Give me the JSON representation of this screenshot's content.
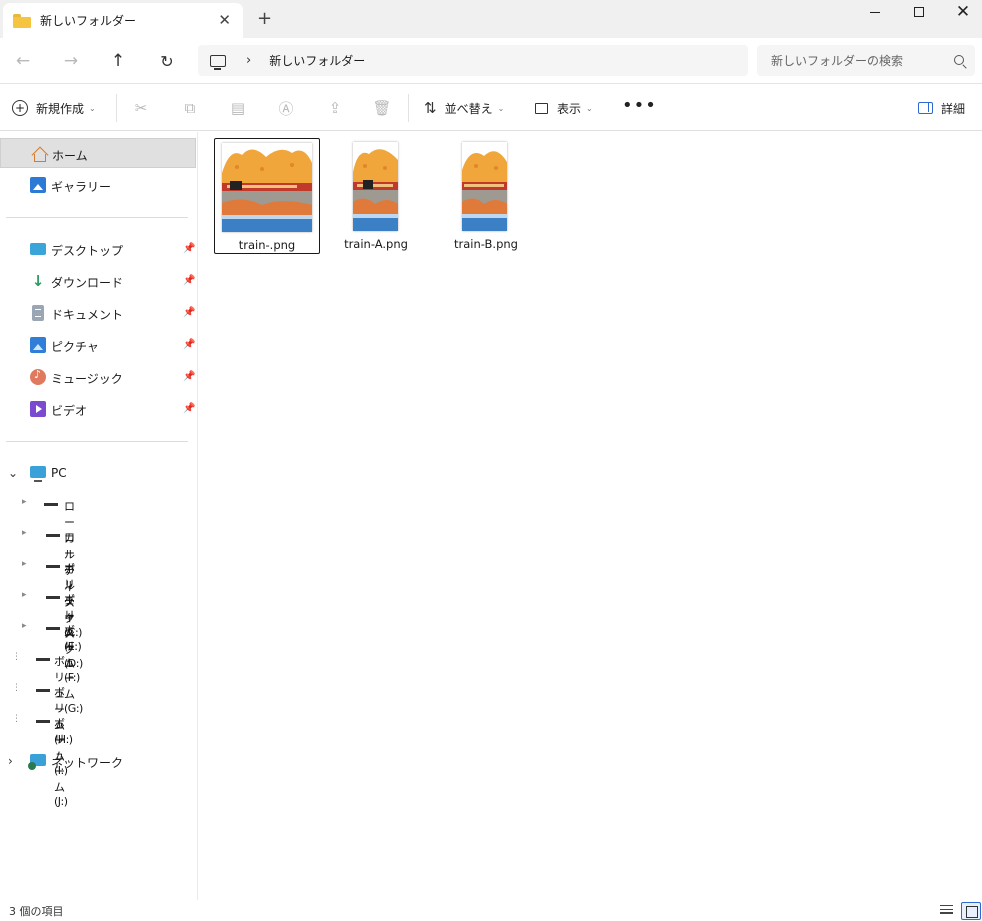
{
  "window": {
    "tab_title": "新しいフォルダー",
    "new_tab": "+",
    "close_tab": "✕",
    "close": "✕"
  },
  "address": {
    "back": "←",
    "forward": "→",
    "up": "↑",
    "refresh": "↻",
    "separator": "›",
    "path": "新しいフォルダー",
    "search_placeholder": "新しいフォルダーの検索"
  },
  "toolbar": {
    "new_label": "新規作成",
    "sort_label": "並べ替え",
    "view_label": "表示",
    "more": "•••",
    "details_label": "詳細",
    "caret": "⌄"
  },
  "sidebar": {
    "home": "ホーム",
    "gallery": "ギャラリー",
    "quick": [
      {
        "label": "デスクトップ"
      },
      {
        "label": "ダウンロード"
      },
      {
        "label": "ドキュメント"
      },
      {
        "label": "ピクチャ"
      },
      {
        "label": "ミュージック"
      },
      {
        "label": "ビデオ"
      }
    ],
    "pc": "PC",
    "drives": [
      {
        "label": "ローカルディスク (C:)"
      },
      {
        "label": "ローカルディスク (D:)"
      },
      {
        "label": "ボリューム (E:)"
      },
      {
        "label": "ボリューム (F:)"
      },
      {
        "label": "ボリューム (G:)"
      },
      {
        "label": "ボリューム (H:)"
      },
      {
        "label": "ボリューム (I:)"
      },
      {
        "label": "ボリューム (J:)"
      }
    ],
    "network": "ネットワーク",
    "pin": "📌"
  },
  "files": [
    {
      "name": "train-.png",
      "selected": true
    },
    {
      "name": "train-A.png",
      "selected": false
    },
    {
      "name": "train-B.png",
      "selected": false
    }
  ],
  "status": {
    "count": "3 個の項目"
  }
}
